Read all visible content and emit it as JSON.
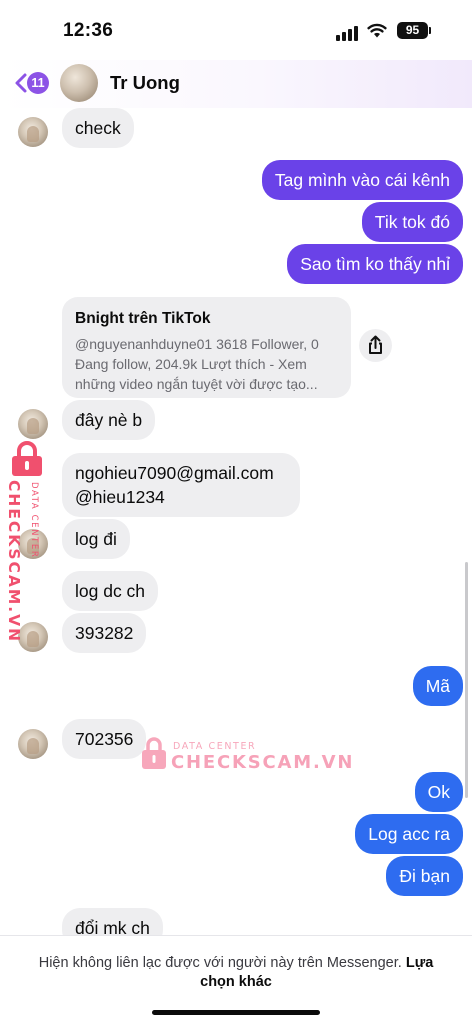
{
  "status": {
    "time": "12:36",
    "battery": "95"
  },
  "header": {
    "back_count": "11",
    "contact_name": "Tr Uong"
  },
  "messages": {
    "m1": "check",
    "m2": "Tag mình vào cái kênh",
    "m3": "Tik tok đó",
    "m4": "Sao tìm ko thấy nhỉ",
    "m5": "đây nè b",
    "m6_line1": "ngohieu7090@gmail.com",
    "m6_line2": "@hieu1234",
    "m7": "log đi",
    "m8": "log dc ch",
    "m9": "393282",
    "m10": "Mã",
    "m11": "702356",
    "m12": "Ok",
    "m13": "Log acc ra",
    "m14": "Đi bạn",
    "m15": "đổi mk ch"
  },
  "link_card": {
    "title": "Bnight trên TikTok",
    "description": "@nguyenanhduyne01 3618 Follower, 0 Đang follow, 204.9k Lượt thích - Xem những video ngắn tuyệt vời được tạo..."
  },
  "watermark": {
    "line1": "DATA CENTER",
    "line2": "CHECKSCAM.VN"
  },
  "footer": {
    "notice": "Hiện không liên lạc được với người này trên Messenger.",
    "action": "Lựa chọn khác"
  },
  "colors": {
    "outgoing_purple": "#6a42e8",
    "outgoing_blue": "#2e6cf0",
    "incoming_gray": "#eeeef0",
    "badge_purple": "#8c53e6",
    "watermark_pink": "#f0506e"
  },
  "icons": {
    "back": "chevron-left-icon",
    "share": "share-icon",
    "signal": "cellular-signal-icon",
    "wifi": "wifi-icon",
    "battery": "battery-icon"
  }
}
